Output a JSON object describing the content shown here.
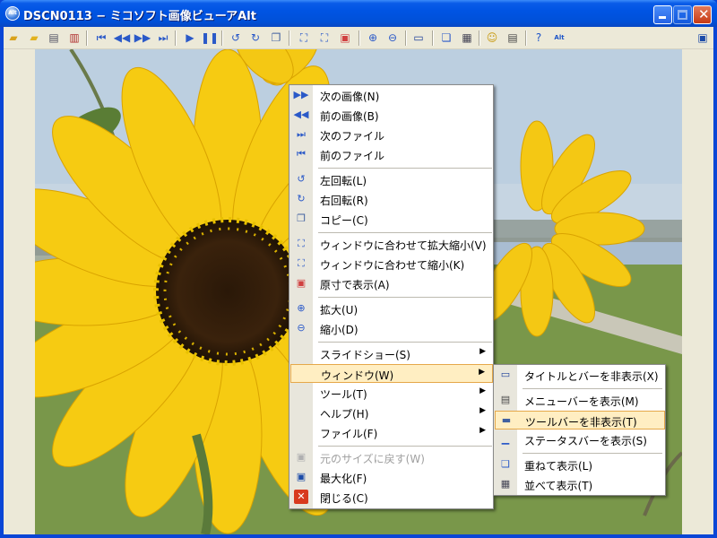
{
  "window": {
    "title": "DSCN0113 − ミコソフト画像ビューアAlt",
    "app_icon": "Alt"
  },
  "toolbar": {
    "icons": [
      "open-folder-icon",
      "open-recent-icon",
      "print-icon",
      "delete-icon",
      "first-image-icon",
      "previous-image-icon",
      "next-image-icon",
      "last-image-icon",
      "play-icon",
      "pause-icon",
      "rotate-left-icon",
      "rotate-right-icon",
      "copy-icon",
      "fit-window-icon",
      "fit-shrink-icon",
      "actual-size-icon",
      "zoom-in-icon",
      "zoom-out-icon",
      "window-icon",
      "cascade-icon",
      "tile-icon",
      "tools-icon",
      "settings-icon",
      "help-icon",
      "about-icon",
      "restore-icon"
    ]
  },
  "context_menu": {
    "items": [
      {
        "label": "次の画像(N)",
        "icon": "next-image-icon"
      },
      {
        "label": "前の画像(B)",
        "icon": "previous-image-icon"
      },
      {
        "label": "次のファイル",
        "icon": "next-file-icon"
      },
      {
        "label": "前のファイル",
        "icon": "previous-file-icon"
      },
      {
        "label": "左回転(L)",
        "icon": "rotate-left-icon"
      },
      {
        "label": "右回転(R)",
        "icon": "rotate-right-icon"
      },
      {
        "label": "コピー(C)",
        "icon": "copy-icon"
      },
      {
        "label": "ウィンドウに合わせて拡大縮小(V)",
        "icon": "fit-window-icon"
      },
      {
        "label": "ウィンドウに合わせて縮小(K)",
        "icon": "fit-shrink-icon"
      },
      {
        "label": "原寸で表示(A)",
        "icon": "actual-size-icon"
      },
      {
        "label": "拡大(U)",
        "icon": "zoom-in-icon"
      },
      {
        "label": "縮小(D)",
        "icon": "zoom-out-icon"
      },
      {
        "label": "スライドショー(S)",
        "icon": ""
      },
      {
        "label": "ウィンドウ(W)",
        "icon": ""
      },
      {
        "label": "ツール(T)",
        "icon": ""
      },
      {
        "label": "ヘルプ(H)",
        "icon": ""
      },
      {
        "label": "ファイル(F)",
        "icon": ""
      },
      {
        "label": "元のサイズに戻す(W)",
        "icon": "restore-icon",
        "disabled": true
      },
      {
        "label": "最大化(F)",
        "icon": "maximize-icon"
      },
      {
        "label": "閉じる(C)",
        "icon": "close-icon"
      }
    ]
  },
  "window_submenu": {
    "items": [
      {
        "label": "タイトルとバーを非表示(X)",
        "icon": "hide-titlebar-icon"
      },
      {
        "label": "メニューバーを表示(M)",
        "icon": "menubar-icon"
      },
      {
        "label": "ツールバーを非表示(T)",
        "icon": "toolbar-icon"
      },
      {
        "label": "ステータスバーを表示(S)",
        "icon": "statusbar-icon"
      },
      {
        "label": "重ねて表示(L)",
        "icon": "cascade-icon"
      },
      {
        "label": "並べて表示(T)",
        "icon": "tile-icon"
      }
    ]
  },
  "colors": {
    "titlebar": "#0054e3",
    "highlight": "#ffeec2",
    "highlight_border": "#e5a84a",
    "sunflower": "#f2c40c"
  }
}
